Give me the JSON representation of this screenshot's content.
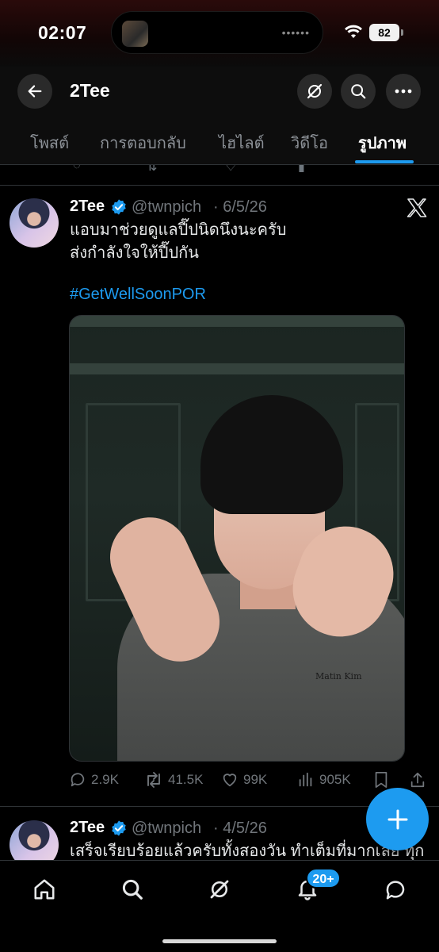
{
  "status_bar": {
    "time": "02:07",
    "island_dots": "••••••",
    "battery": "82"
  },
  "header": {
    "title": "2Tee"
  },
  "tabs": [
    {
      "label": "โพสต์",
      "active": false
    },
    {
      "label": "การตอบกลับ",
      "active": false
    },
    {
      "label": "ไฮไลต์",
      "active": false
    },
    {
      "label": "วิดีโอ",
      "active": false
    },
    {
      "label": "รูปภาพ",
      "active": true
    }
  ],
  "tweets": [
    {
      "name": "2Tee",
      "handle": "@twnpich",
      "date": "· 6/5/26",
      "lines": [
        "แอบมาช่วยดูแลปี๊ปนิดนึงนะครับ",
        "ส่งกำลังใจให้ปี๊ปกัน"
      ],
      "hashtag": "#GetWellSoonPOR",
      "photo_text": "Matin  Kim",
      "stats": {
        "replies": "2.9K",
        "reposts": "41.5K",
        "likes": "99K",
        "views": "905K"
      }
    },
    {
      "name": "2Tee",
      "handle": "@twnpich",
      "date": "· 4/5/26",
      "lines": [
        "เสร็จเรียบร้อยแล้วครับทั้งสองวัน ทำเต็มที่มากเลย ทุก"
      ]
    }
  ],
  "nav": {
    "notifications_badge": "20+"
  },
  "colors": {
    "accent": "#1d9bf0",
    "background": "#000000",
    "muted": "#71767b"
  }
}
